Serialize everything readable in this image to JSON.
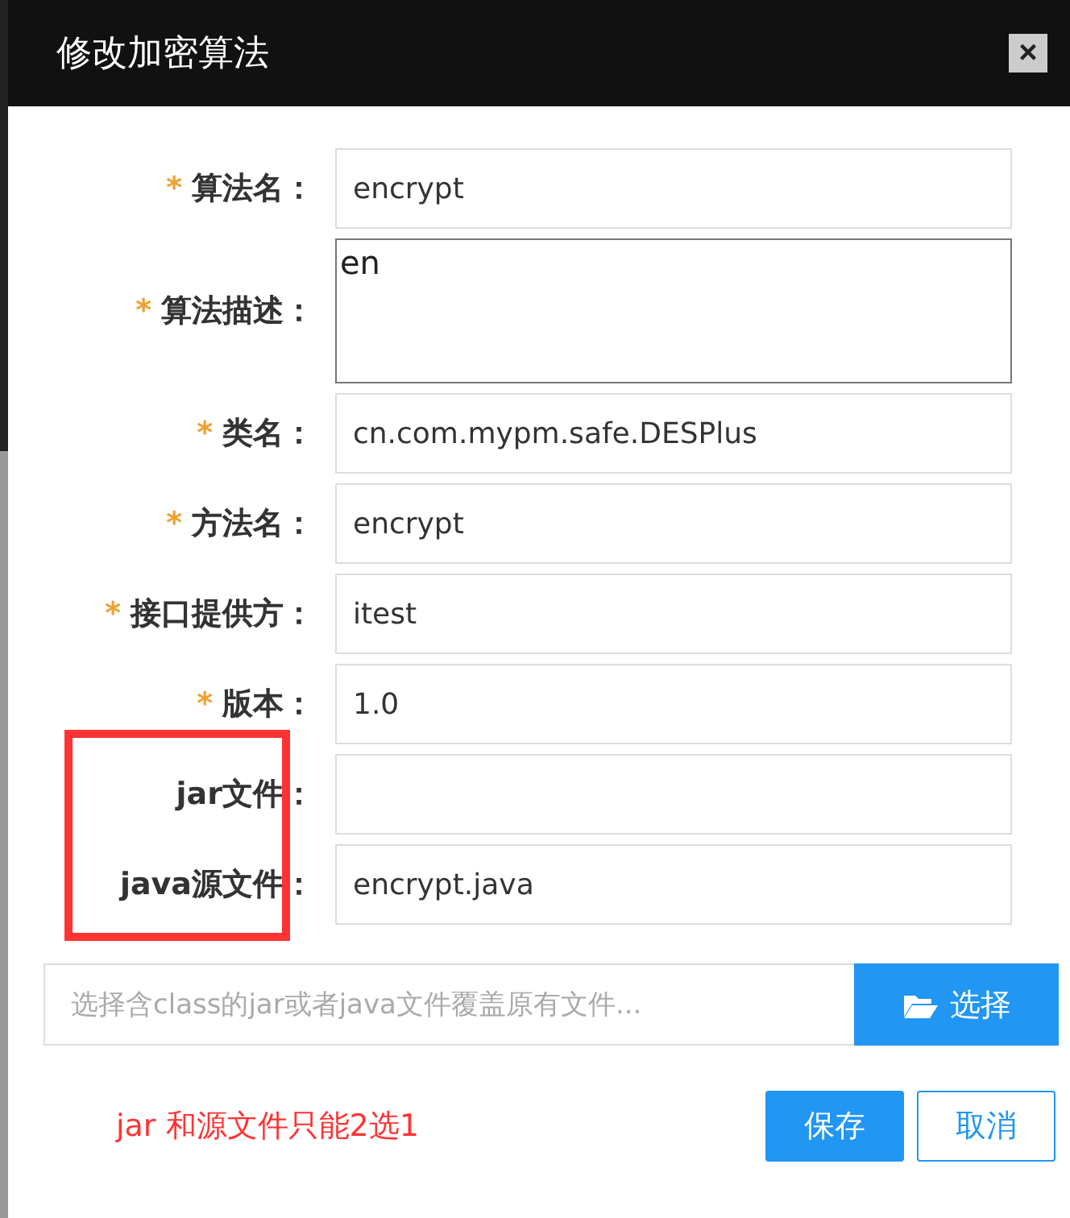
{
  "dialog": {
    "title": "修改加密算法",
    "close": "×"
  },
  "fields": [
    {
      "label": "算法名：",
      "required": true,
      "kind": "input",
      "value": "encrypt",
      "highlighted": false
    },
    {
      "label": "算法描述：",
      "required": true,
      "kind": "textarea",
      "value": "en",
      "highlighted": false
    },
    {
      "label": "类名：",
      "required": true,
      "kind": "input",
      "value": "cn.com.mypm.safe.DESPlus",
      "highlighted": false
    },
    {
      "label": "方法名：",
      "required": true,
      "kind": "input",
      "value": "encrypt",
      "highlighted": false
    },
    {
      "label": "接口提供方：",
      "required": true,
      "kind": "input",
      "value": "itest",
      "highlighted": false
    },
    {
      "label": "版本：",
      "required": true,
      "kind": "input",
      "value": "1.0",
      "highlighted": false
    },
    {
      "label": "jar文件：",
      "required": false,
      "kind": "input",
      "highlighted": true
    },
    {
      "label": "java源文件：",
      "required": false,
      "kind": "input",
      "value": "encrypt.java",
      "highlighted": true
    }
  ],
  "required_mark": "*",
  "file_picker": {
    "placeholder": "选择含class的jar或者java文件覆盖原有文件...",
    "button": "选择"
  },
  "note": "jar 和源文件只能2选1",
  "buttons": [
    {
      "label": "保存",
      "kind": "primary"
    },
    {
      "label": "取消",
      "kind": "secondary"
    }
  ]
}
